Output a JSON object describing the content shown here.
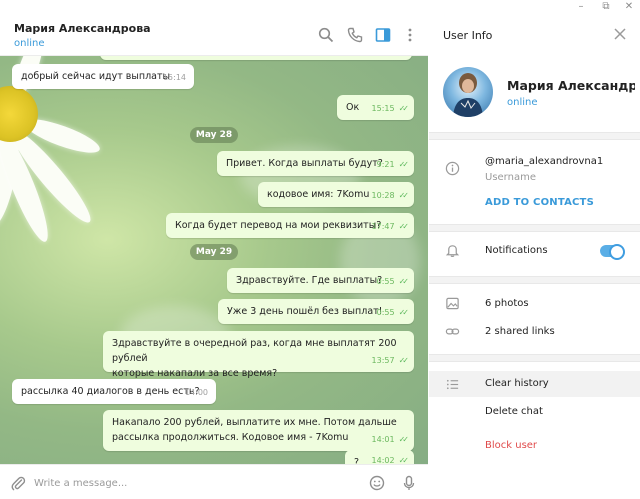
{
  "window": {
    "controls": [
      "–",
      "⧉",
      "✕"
    ]
  },
  "chat": {
    "peer_name": "Мария Александрова",
    "peer_status": "online",
    "header_icons": [
      "search-icon",
      "phone-icon",
      "sidebar-toggle-icon",
      "more-icon"
    ],
    "messages": [
      {
        "dir": "in",
        "text": "добрый сейчас идут выплаты",
        "time": "15:14"
      },
      {
        "dir": "out",
        "text": "Ок",
        "time": "15:15"
      },
      {
        "dir": "date",
        "text": "May 28"
      },
      {
        "dir": "out",
        "text": "Привет. Когда выплаты будут?",
        "time": "9:21"
      },
      {
        "dir": "out",
        "text": "кодовое имя: 7Komu",
        "time": "10:28"
      },
      {
        "dir": "out",
        "text": "Когда будет перевод на мои реквизиты?",
        "time": "17:47"
      },
      {
        "dir": "date",
        "text": "May 29"
      },
      {
        "dir": "out",
        "text": "Здравствуйте. Где выплаты?",
        "time": "0:55"
      },
      {
        "dir": "out",
        "text": "Уже 3 день пошёл без выплат!",
        "time": "0:55"
      },
      {
        "dir": "out",
        "text": "Здравствуйте в очередной раз, когда мне выплатят 200 рублей",
        "text2": "которые накапали за все время?",
        "time": "13:57"
      },
      {
        "dir": "in",
        "text": "рассылка 40 диалогов в день есть?",
        "time": "14:00"
      },
      {
        "dir": "out",
        "text": "Накапало 200 рублей, выплатите их мне. Потом дальше",
        "text2": "рассылка продолжиться. Кодовое имя - 7Komu",
        "time": "14:01"
      },
      {
        "dir": "out",
        "text": "?",
        "time": "14:02"
      }
    ],
    "composer_placeholder": "Write a message..."
  },
  "info": {
    "title": "User Info",
    "name": "Мария Александр...",
    "status": "online",
    "username": "@maria_alexandrovna1",
    "username_label": "Username",
    "add_contact": "ADD TO CONTACTS",
    "notifications": "Notifications",
    "notifications_on": true,
    "photos": "6 photos",
    "links": "2 shared links",
    "clear_history": "Clear history",
    "delete_chat": "Delete chat",
    "block_user": "Block user",
    "colors": {
      "accent": "#3a9ad9",
      "danger": "#e04a4a",
      "out_bubble": "#effdde"
    }
  }
}
